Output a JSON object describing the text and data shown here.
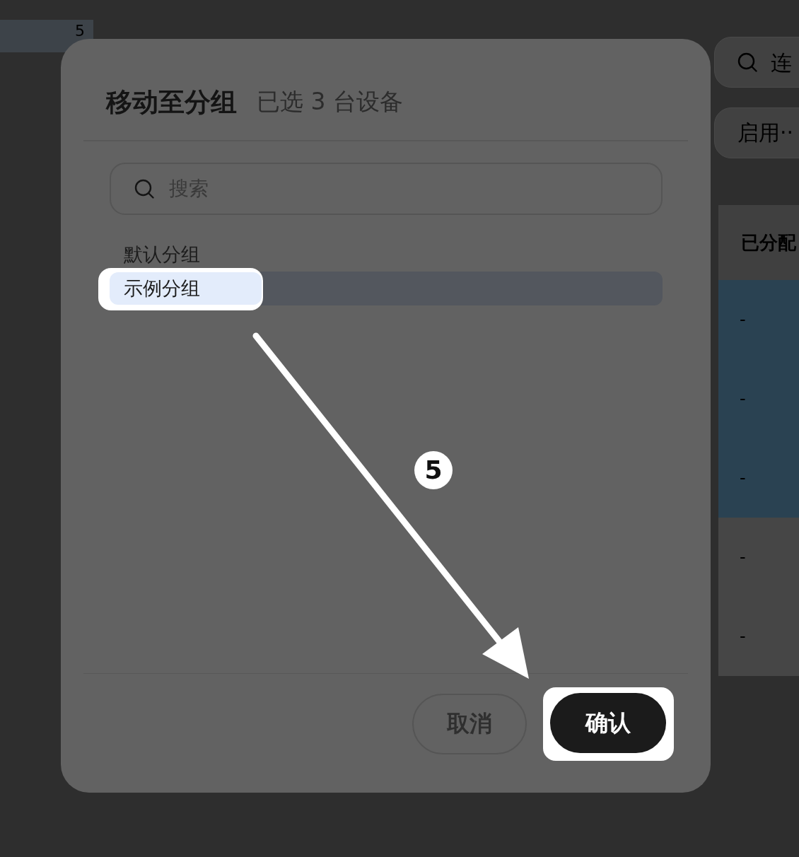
{
  "background_page": {
    "count": "5",
    "search": {
      "placeholder": "连"
    },
    "filter": {
      "value": "启用··"
    },
    "section_title": "已分配",
    "rows": [
      {
        "cell": "-",
        "selected": true
      },
      {
        "cell": "-",
        "selected": true
      },
      {
        "cell": "-",
        "selected": true
      },
      {
        "cell": "-",
        "selected": false
      },
      {
        "cell": "-",
        "selected": false
      }
    ]
  },
  "dialog": {
    "title": "移动至分组",
    "subtitle": "已选 3 台设备",
    "search": {
      "placeholder": "搜索"
    },
    "groups": [
      {
        "label": "默认分组",
        "selected": false,
        "highlighted": false
      },
      {
        "label": "示例分组",
        "selected": true,
        "highlighted": true
      }
    ],
    "buttons": [
      {
        "label": "取消",
        "kind": "secondary",
        "highlighted": false
      },
      {
        "label": "确认",
        "kind": "primary",
        "highlighted": true
      }
    ]
  },
  "tutorial": {
    "step": "5"
  }
}
